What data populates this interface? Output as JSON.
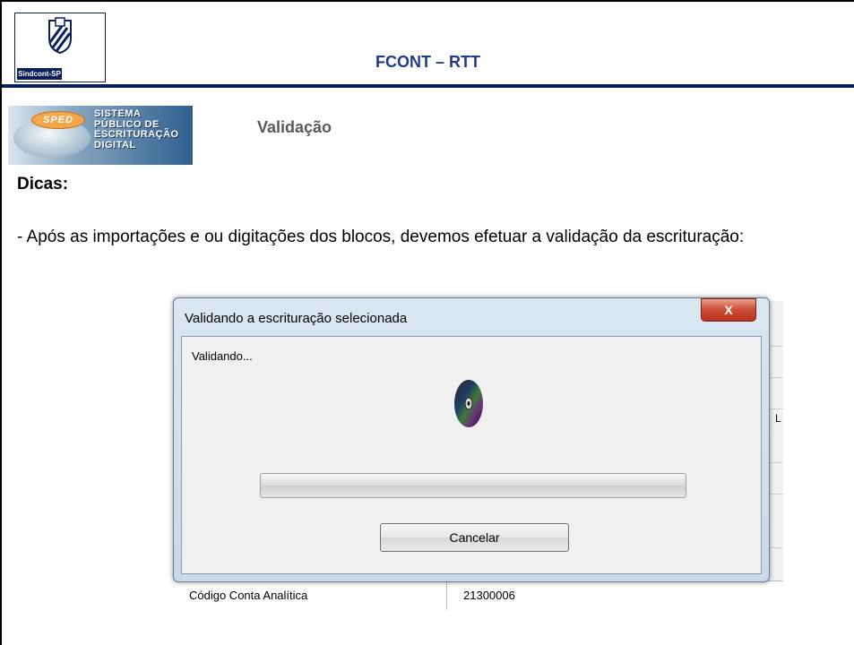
{
  "header": {
    "title": "FCONT – RTT",
    "logo_caption": "Sindcont-SP"
  },
  "sped_logo": {
    "badge": "SPED",
    "lines": [
      "SISTEMA",
      "PÚBLICO DE",
      "ESCRITURAÇÃO",
      "DIGITAL"
    ]
  },
  "section_title": "Validação",
  "dicas": {
    "heading": "Dicas:",
    "text": "- Após as importações e ou digitações dos blocos, devemos efetuar a validação da escrituração:"
  },
  "dialog": {
    "title": "Validando a escrituração selecionada",
    "close_label": "X",
    "status": "Validando...",
    "progress": 0,
    "cancel_label": "Cancelar",
    "icon": "disc-icon"
  },
  "background_table": {
    "label": "Código Conta Analítica",
    "value": "21300006",
    "edge_letter": "L"
  },
  "colors": {
    "header_title": "#1f3c8c",
    "header_rule": "#0b1f5c",
    "section_title": "#595959",
    "close_button": "#c4412b"
  }
}
